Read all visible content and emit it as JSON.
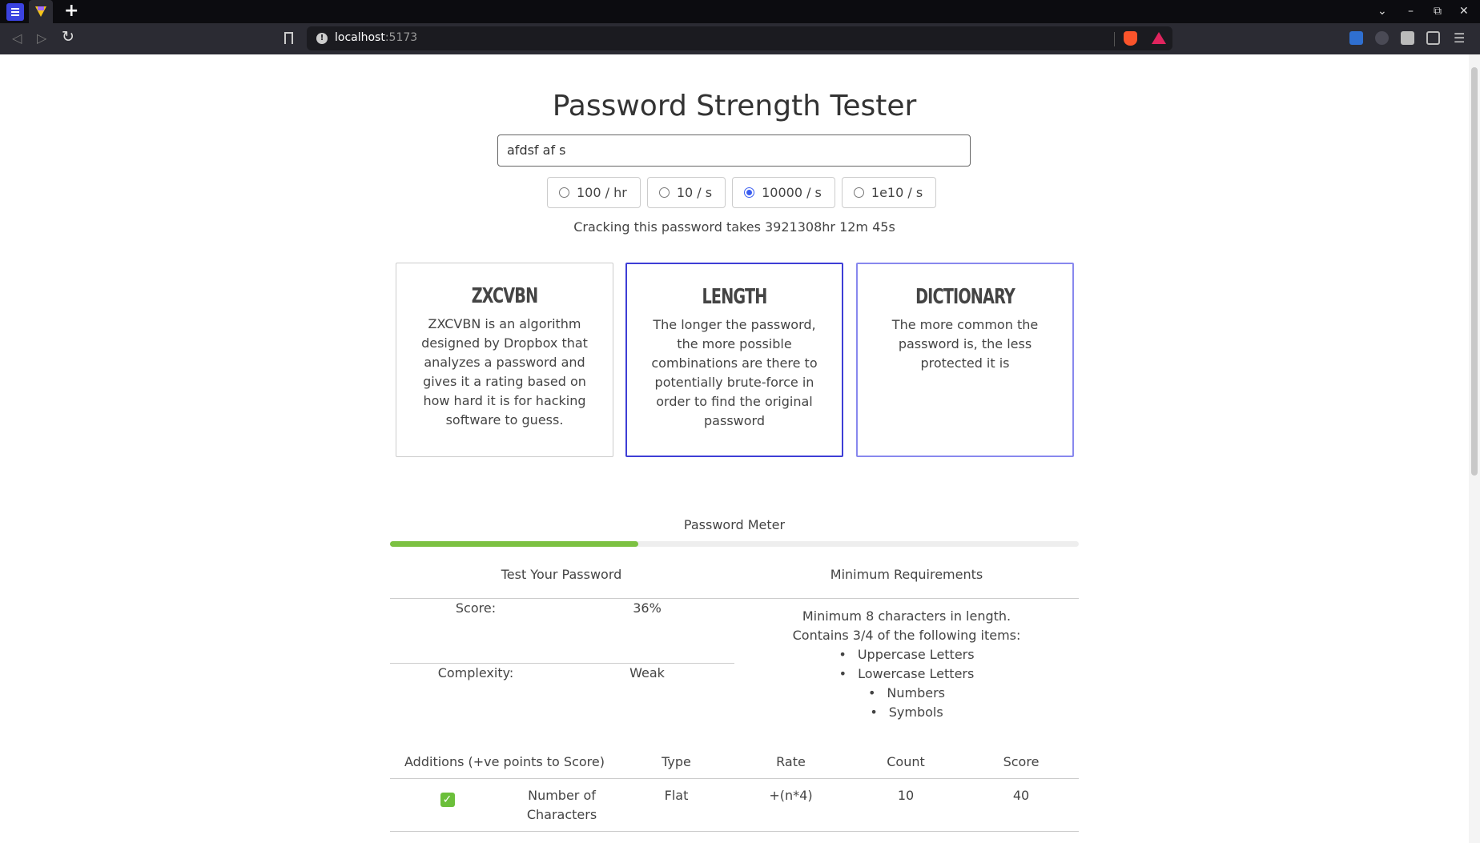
{
  "browser": {
    "url_host": "localhost",
    "url_port": ":5173"
  },
  "app": {
    "title": "Password Strength Tester",
    "password_value": "afdsf af s",
    "rates": [
      {
        "label": "100 / hr",
        "selected": false
      },
      {
        "label": "10 / s",
        "selected": false
      },
      {
        "label": "10000 / s",
        "selected": true
      },
      {
        "label": "1e10 / s",
        "selected": false
      }
    ],
    "crack_time": "Cracking this password takes 3921308hr 12m 45s"
  },
  "cards": [
    {
      "title": "ZXCVBN",
      "text": "ZXCVBN is an algorithm designed by Dropbox that analyzes a password and gives it a rating based on how hard it is for hacking software to guess."
    },
    {
      "title": "LENGTH",
      "text": "The longer the password, the more possible combinations are there to potentially brute-force in order to find the original password"
    },
    {
      "title": "DICTIONARY",
      "text": "The more common the password is, the less protected it is"
    }
  ],
  "meter": {
    "label": "Password Meter",
    "fill_percent": 36
  },
  "test": {
    "heading": "Test Your Password",
    "score_label": "Score:",
    "score_value": "36%",
    "complexity_label": "Complexity:",
    "complexity_value": "Weak"
  },
  "requirements": {
    "heading": "Minimum Requirements",
    "line1": "Minimum 8 characters in length.",
    "line2": "Contains 3/4 of the following items:",
    "items": [
      "Uppercase Letters",
      "Lowercase Letters",
      "Numbers",
      "Symbols"
    ]
  },
  "additions": {
    "headers": [
      "Additions (+ve points to Score)",
      "Type",
      "Rate",
      "Count",
      "Score"
    ],
    "rows": [
      {
        "check": "✓",
        "name": "Number of Characters",
        "type": "Flat",
        "rate": "+(n*4)",
        "count": "10",
        "score": "40"
      }
    ]
  },
  "colors": {
    "accent": "#3e3ed6",
    "meter": "#7cc142",
    "radio": "#3b5ef0"
  }
}
